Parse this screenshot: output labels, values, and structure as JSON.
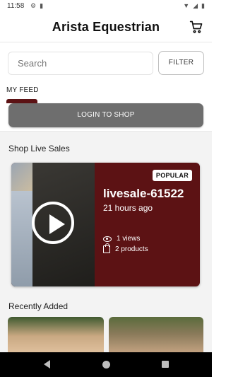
{
  "status_bar": {
    "time": "11:58",
    "left_icons": [
      "gear-icon",
      "sim-card-icon"
    ],
    "right_icons": [
      "wifi-icon",
      "signal-icon",
      "battery-icon"
    ]
  },
  "header": {
    "title": "Arista Equestrian",
    "cart_icon": "cart-icon"
  },
  "search": {
    "placeholder": "Search",
    "filter_label": "FILTER"
  },
  "feed": {
    "tab_label": "MY FEED",
    "login_label": "LOGIN TO SHOP"
  },
  "live_sales": {
    "section_title": "Shop Live Sales",
    "items": [
      {
        "badge": "POPULAR",
        "name": "livesale-61522",
        "time_ago": "21 hours ago",
        "views": "1 views",
        "products": "2 products",
        "accent_color": "#5c1214"
      }
    ]
  },
  "recently_added": {
    "section_title": "Recently Added"
  },
  "nav": {
    "icons": [
      "back-icon",
      "home-icon",
      "recents-icon"
    ]
  },
  "colors": {
    "brand": "#5c1214",
    "login_button": "#6e6e6e",
    "content_bg": "#f3f3f3"
  }
}
